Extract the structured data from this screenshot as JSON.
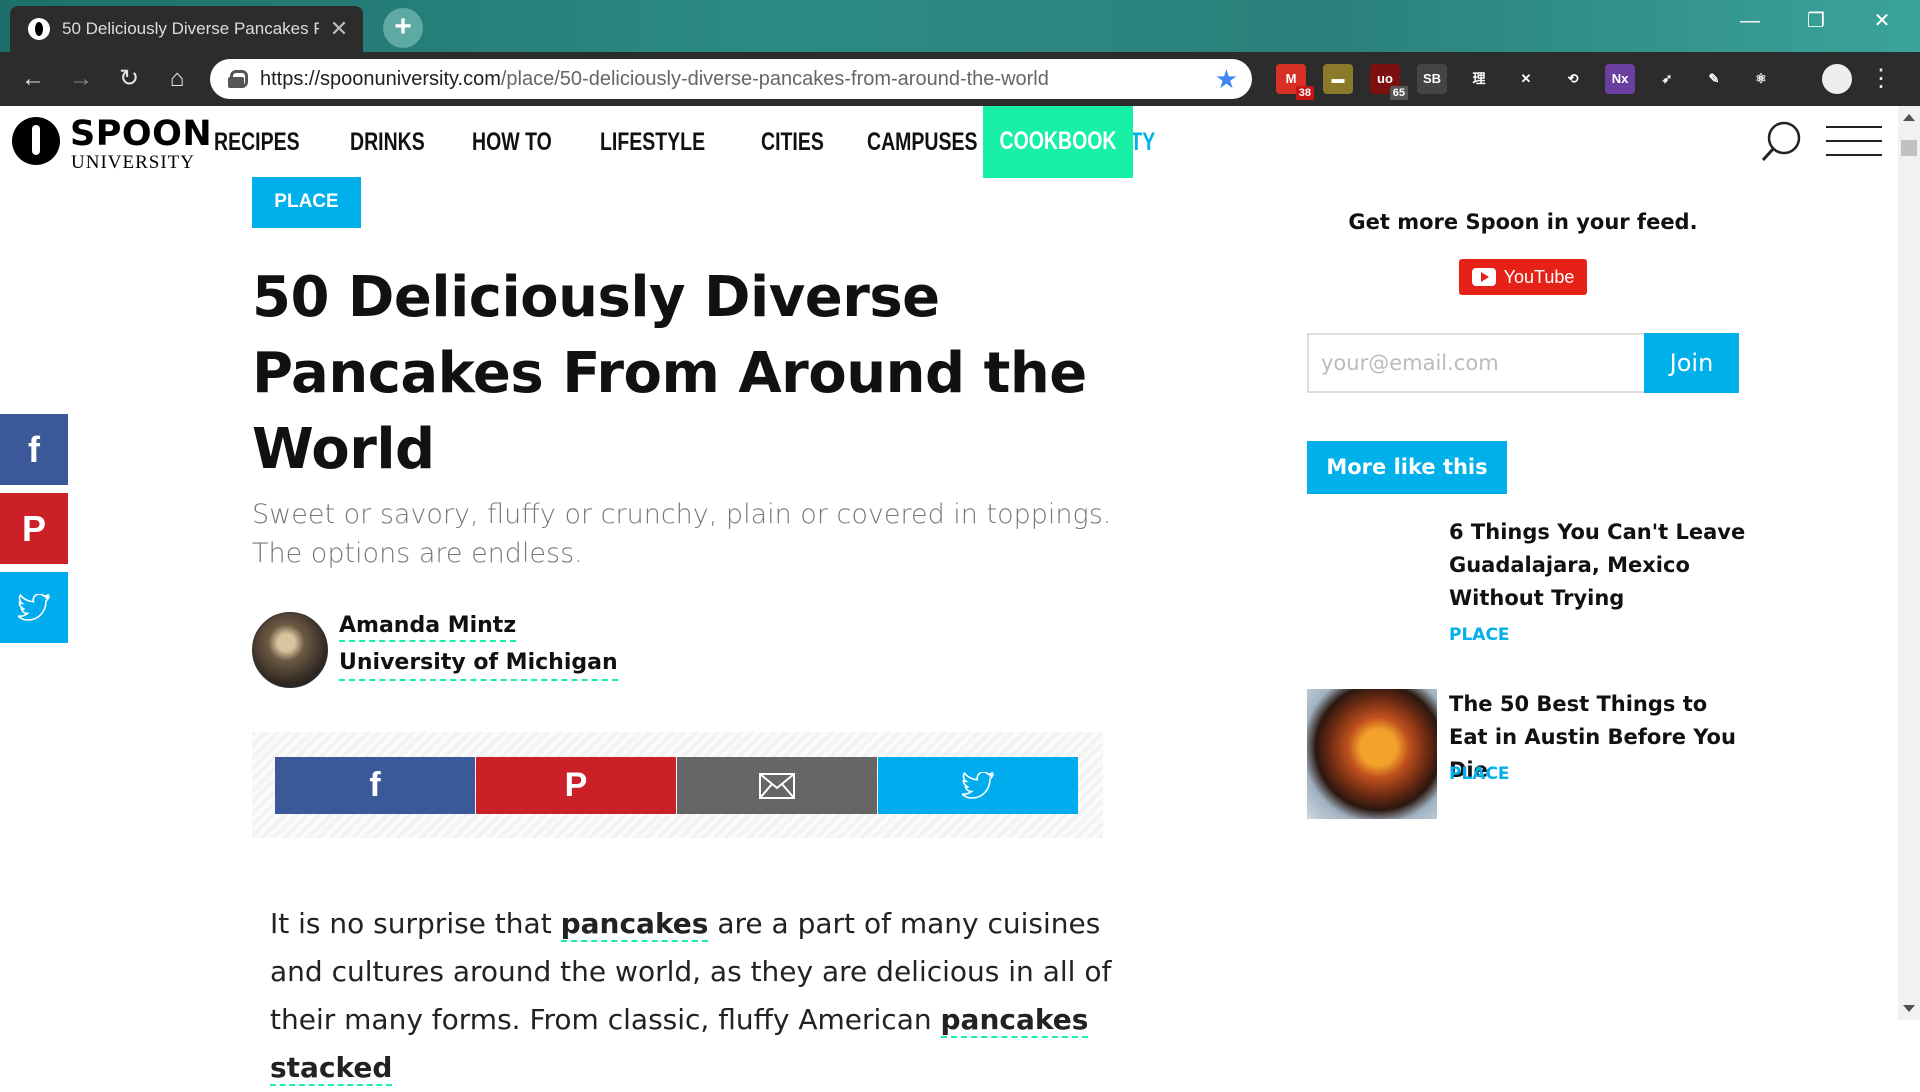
{
  "browser": {
    "tab_title": "50 Deliciously Diverse Pancakes F",
    "tab_close": "✕",
    "new_tab": "+",
    "window_buttons": [
      "—",
      "❐",
      "✕"
    ],
    "url_host": "https://spoonuniversity.com",
    "url_path": "/place/50-deliciously-diverse-pancakes-from-around-the-world",
    "nav_icons": [
      "←",
      "→",
      "↻",
      "⌂"
    ],
    "bookmark_icon": "★",
    "extensions": [
      {
        "name": "gmail-icon",
        "label": "M",
        "badge": "38",
        "color": "#d93025"
      },
      {
        "name": "note-icon",
        "label": "▬",
        "badge": "",
        "color": "#8a7a2a"
      },
      {
        "name": "ublock-icon",
        "label": "uo",
        "badge": "65",
        "color": "#7a1010"
      },
      {
        "name": "sb-icon",
        "label": "SB",
        "badge": "",
        "color": "#444"
      },
      {
        "name": "dictionary-icon",
        "label": "理",
        "badge": "",
        "color": "#2c2c2c"
      },
      {
        "name": "x-icon",
        "label": "✕",
        "badge": "",
        "color": "#2c2c2c"
      },
      {
        "name": "sync-icon",
        "label": "⟲",
        "badge": "",
        "color": "#2c2c2c"
      },
      {
        "name": "nx-icon",
        "label": "Nx",
        "badge": "",
        "color": "#6b3fa0"
      },
      {
        "name": "bird-icon",
        "label": "➶",
        "badge": "",
        "color": "#2c2c2c"
      },
      {
        "name": "pen-icon",
        "label": "✎",
        "badge": "",
        "color": "#2c2c2c"
      },
      {
        "name": "react-icon",
        "label": "⚛",
        "badge": "",
        "color": "#2c2c2c"
      }
    ],
    "menu_icon": "⋮"
  },
  "header": {
    "logo_top": "SPOON",
    "logo_bottom": "UNIVERSITY",
    "nav": [
      "RECIPES",
      "DRINKS",
      "HOW TO",
      "LIFESTYLE",
      "CITIES",
      "CAMPUSES",
      "COMMUNITY"
    ],
    "cookbook": "COOKBOOK"
  },
  "article": {
    "category": "PLACE",
    "headline": "50 Deliciously Diverse Pancakes From Around the World",
    "dek": "Sweet or savory, fluffy or crunchy, plain or covered in toppings. The options are endless.",
    "author": "Amanda Mintz",
    "school": "University of Michigan",
    "body_start": "It is no surprise that",
    "body_link": "pancakes",
    "body_mid": "are a part of many cuisines and cultures around the world, as they are delicious in all of their many forms. From classic, fluffy American",
    "body_link2": "pancakes stacked"
  },
  "share": {
    "facebook": "f",
    "pinterest": "P",
    "email": "✉",
    "twitter": "🐦",
    "colors": {
      "facebook": "#3b5998",
      "pinterest": "#cb2027",
      "email": "#666666",
      "twitter": "#00aced"
    }
  },
  "sidebar": {
    "feed_title": "Get more Spoon in your feed.",
    "youtube": "YouTube",
    "email_placeholder": "your@email.com",
    "join": "Join",
    "more_like": "More like this",
    "related": [
      {
        "title": "6 Things You Can't Leave Guadalajara, Mexico Without Trying",
        "tag": "PLACE"
      },
      {
        "title": "The 50 Best Things to Eat in Austin Before You Die",
        "tag": "PLACE"
      }
    ]
  }
}
